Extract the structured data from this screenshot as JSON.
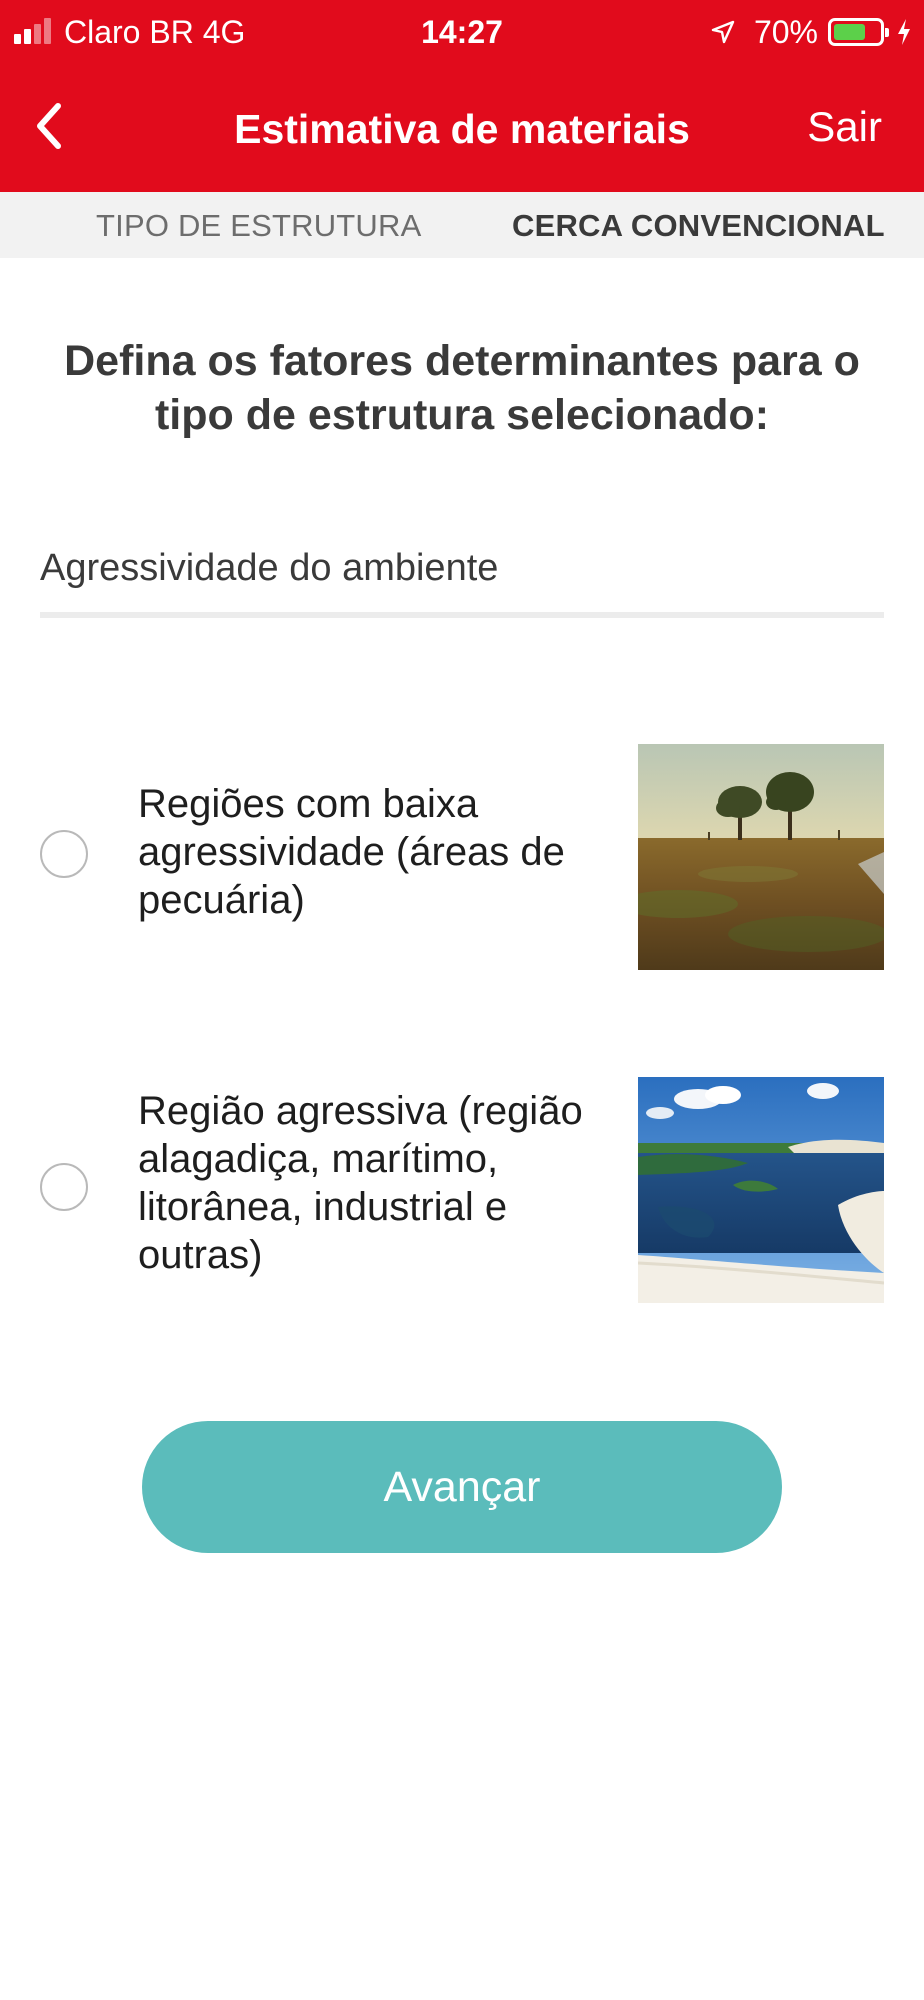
{
  "status_bar": {
    "carrier": "Claro BR  4G",
    "time": "14:27",
    "battery": "70%",
    "battery_level": 0.7,
    "icons": [
      "signal-icon",
      "location-arrow-icon",
      "battery-icon",
      "charging-bolt-icon"
    ]
  },
  "nav": {
    "back_icon": "chevron-left-icon",
    "title": "Estimativa de materiais",
    "exit_label": "Sair"
  },
  "breadcrumb": {
    "step1": "TIPO DE ESTRUTURA",
    "step2": "CERCA CONVENCIONAL"
  },
  "main": {
    "title": "Defina os fatores determinantes para o tipo de estrutura selecionado:",
    "section_label": "Agressividade do ambiente",
    "options": [
      {
        "label": "Regiões com baixa agressividade (áreas de pecuária)",
        "selected": false,
        "image": "savanna-landscape-photo"
      },
      {
        "label": "Região agressiva (região alagadiça, marítimo, litorânea, industrial e outras)",
        "selected": false,
        "image": "coastal-lagoon-dunes-photo"
      }
    ],
    "next_label": "Avançar"
  },
  "colors": {
    "header": "#e10b1c",
    "breadcrumb_bg": "#f2f2f2",
    "button": "#5bbcbb",
    "battery": "#5cd04a"
  }
}
